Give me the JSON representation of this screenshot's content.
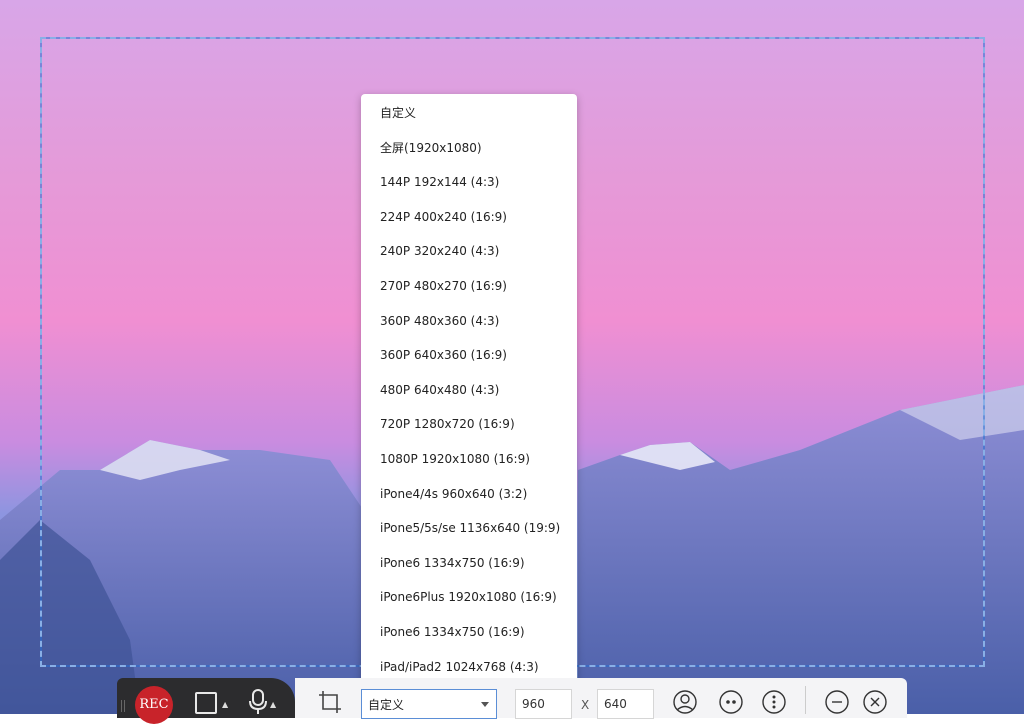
{
  "dropdown": {
    "options": [
      "自定义",
      "全屏(1920x1080)",
      "144P 192x144 (4:3)",
      "224P 400x240 (16:9)",
      "240P 320x240 (4:3)",
      "270P 480x270 (16:9)",
      "360P 480x360 (4:3)",
      "360P 640x360 (16:9)",
      "480P 640x480 (4:3)",
      "720P 1280x720 (16:9)",
      "1080P 1920x1080 (16:9)",
      "iPone4/4s 960x640 (3:2)",
      "iPone5/5s/se 1136x640 (19:9)",
      "iPone6 1334x750 (16:9)",
      "iPone6Plus 1920x1080 (16:9)",
      "iPone6 1334x750 (16:9)",
      "iPad/iPad2 1024x768 (4:3)"
    ]
  },
  "toolbar": {
    "rec_label": "REC",
    "size_select_value": "自定义",
    "width_value": "960",
    "times_label": "X",
    "height_value": "640"
  },
  "icons": {
    "grip": "drag-grip-icon",
    "area": "square-area-icon",
    "mic": "microphone-icon",
    "crop": "crop-icon",
    "webcam": "webcam-person-icon",
    "more": "more-dots-icon",
    "options": "vertical-dots-icon",
    "minimize": "minimize-icon",
    "close": "close-icon"
  },
  "colors": {
    "rec": "#c8232a",
    "selection_border": "#ffffff",
    "select_border": "#5b8ed6"
  }
}
